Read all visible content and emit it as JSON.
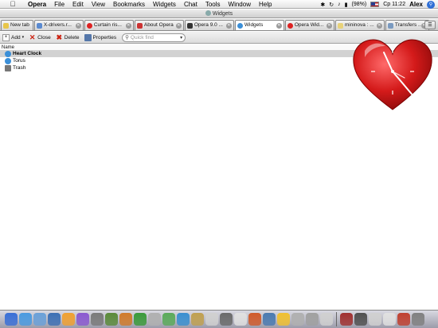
{
  "menubar": {
    "app_name": "Opera",
    "menus": [
      "File",
      "Edit",
      "View",
      "Bookmarks",
      "Widgets",
      "Chat",
      "Tools",
      "Window",
      "Help"
    ],
    "battery": "(98%)",
    "clock": "Ср 11:22",
    "user": "Alex"
  },
  "window": {
    "title": "Widgets"
  },
  "tabs": [
    {
      "label": "New tab",
      "active": false
    },
    {
      "label": "X-drivers.r...",
      "active": false
    },
    {
      "label": "Curtain ris...",
      "active": false
    },
    {
      "label": "About Opera",
      "active": false
    },
    {
      "label": "Opera 9.0 ...",
      "active": false
    },
    {
      "label": "Widgets",
      "active": true
    },
    {
      "label": "Opera Wid...",
      "active": false
    },
    {
      "label": "mininova : ...",
      "active": false
    },
    {
      "label": "Transfers ...",
      "active": false
    }
  ],
  "toolbar": {
    "add_label": "Add",
    "close_label": "Close",
    "delete_label": "Delete",
    "properties_label": "Properties",
    "quickfind_placeholder": "Quick find"
  },
  "list": {
    "column_header": "Name",
    "items": [
      {
        "label": "Heart Clock",
        "selected": true,
        "icon": "widget-icon"
      },
      {
        "label": "Torus",
        "selected": false,
        "icon": "widget-icon"
      },
      {
        "label": "Trash",
        "selected": false,
        "icon": "trash-icon"
      }
    ]
  },
  "widget": {
    "name": "heart-clock",
    "heart_color": "#d41a1a"
  },
  "dock": {
    "colors": [
      "#3a6fd6",
      "#4a9ae0",
      "#6aa0d8",
      "#3c6fb4",
      "#f0a030",
      "#8a5ad0",
      "#7a7a7a",
      "#5a8a3a",
      "#d07a2a",
      "#3a9a3a",
      "#b0b0b0",
      "#5aaa5a",
      "#3a8fd0",
      "#c0a050",
      "#d0d0d0",
      "#6a6a6a",
      "#e0e0e0",
      "#d05a2a",
      "#4a7ab0",
      "#f0c030",
      "#b0b0b0",
      "#a0a0a0",
      "#d0d0d0",
      "#a03030",
      "#505050",
      "#d0d0d0",
      "#e0e0e0",
      "#c04030",
      "#808080"
    ]
  }
}
